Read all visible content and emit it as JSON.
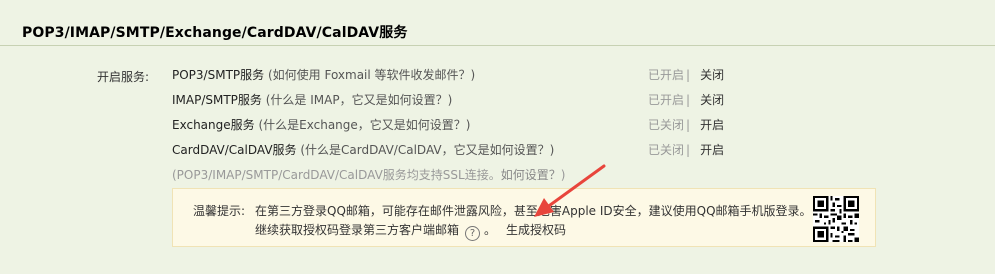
{
  "section": {
    "title": "POP3/IMAP/SMTP/Exchange/CardDAV/CalDAV服务"
  },
  "services_label": "开启服务:",
  "services": [
    {
      "name": "POP3/SMTP服务",
      "help": "(如何使用 Foxmail 等软件收发邮件？)",
      "status": "已开启",
      "separator": "|",
      "toggle": "关闭"
    },
    {
      "name": "IMAP/SMTP服务",
      "help": "(什么是 IMAP，它又是如何设置？)",
      "status": "已开启",
      "separator": "|",
      "toggle": "关闭"
    },
    {
      "name": "Exchange服务",
      "help": "(什么是Exchange，它又是如何设置？)",
      "status": "已关闭",
      "separator": "|",
      "toggle": "开启"
    },
    {
      "name": "CardDAV/CalDAV服务",
      "help": "(什么是CardDAV/CalDAV，它又是如何设置？)",
      "status": "已关闭",
      "separator": "|",
      "toggle": "开启"
    }
  ],
  "ssl_note": {
    "text": "(POP3/IMAP/SMTP/CardDAV/CalDAV服务均支持SSL连接。",
    "link": "如何设置？",
    "close": ")"
  },
  "tip": {
    "label": "温馨提示:",
    "line1": "在第三方登录QQ邮箱，可能存在邮件泄露风险，甚至危害Apple ID安全，建议使用QQ邮箱手机版登录。",
    "line2": "继续获取授权码登录第三方客户端邮箱",
    "help_icon_text": "?",
    "period": "。",
    "generate_link": "生成授权码"
  },
  "colors": {
    "background": "#eef3e4",
    "tip_bg": "#fdf9e6",
    "arrow": "#e8453c"
  }
}
